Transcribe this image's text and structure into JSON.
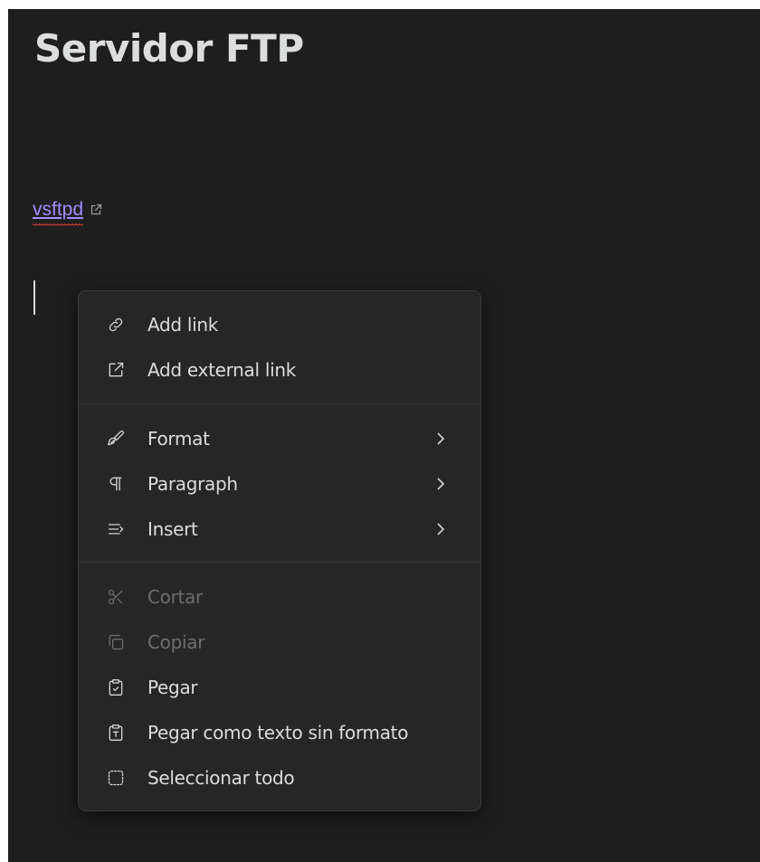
{
  "note": {
    "title": "Servidor FTP",
    "link_text": "vsftpd"
  },
  "context_menu": {
    "groups": [
      [
        {
          "label": "Add link",
          "icon": "link-icon",
          "enabled": true,
          "submenu": false
        },
        {
          "label": "Add external link",
          "icon": "external-link-icon",
          "enabled": true,
          "submenu": false
        }
      ],
      [
        {
          "label": "Format",
          "icon": "paintbrush-icon",
          "enabled": true,
          "submenu": true
        },
        {
          "label": "Paragraph",
          "icon": "pilcrow-icon",
          "enabled": true,
          "submenu": true
        },
        {
          "label": "Insert",
          "icon": "list-insert-icon",
          "enabled": true,
          "submenu": true
        }
      ],
      [
        {
          "label": "Cortar",
          "icon": "scissors-icon",
          "enabled": false,
          "submenu": false
        },
        {
          "label": "Copiar",
          "icon": "copy-icon",
          "enabled": false,
          "submenu": false
        },
        {
          "label": "Pegar",
          "icon": "clipboard-check-icon",
          "enabled": true,
          "submenu": false
        },
        {
          "label": "Pegar como texto sin formato",
          "icon": "clipboard-text-icon",
          "enabled": true,
          "submenu": false
        },
        {
          "label": "Seleccionar todo",
          "icon": "select-all-icon",
          "enabled": true,
          "submenu": false
        }
      ]
    ]
  },
  "colors": {
    "editor_background": "#1e1e1e",
    "menu_background": "#262626",
    "link": "#a58cff",
    "spellcheck_underline": "#e0403a",
    "text": "#dcdcdc",
    "disabled_text": "#6e6e6e"
  }
}
